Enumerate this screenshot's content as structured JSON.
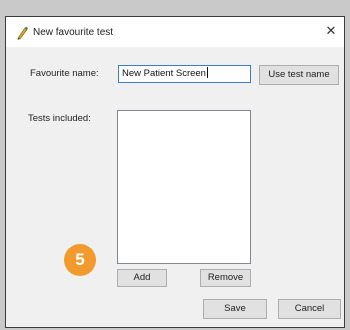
{
  "dialog": {
    "title": "New favourite test",
    "icon": "pencil-icon",
    "close_glyph": "✕"
  },
  "form": {
    "favourite_name_label": "Favourite name:",
    "favourite_name_value": "New Patient Screen",
    "use_test_name_label": "Use test name",
    "tests_included_label": "Tests included:",
    "tests_included_items": []
  },
  "list_actions": {
    "add_label": "Add",
    "remove_label": "Remove"
  },
  "footer": {
    "save_label": "Save",
    "cancel_label": "Cancel"
  },
  "annotation": {
    "step_number": "5",
    "color": "#f39a2e"
  }
}
